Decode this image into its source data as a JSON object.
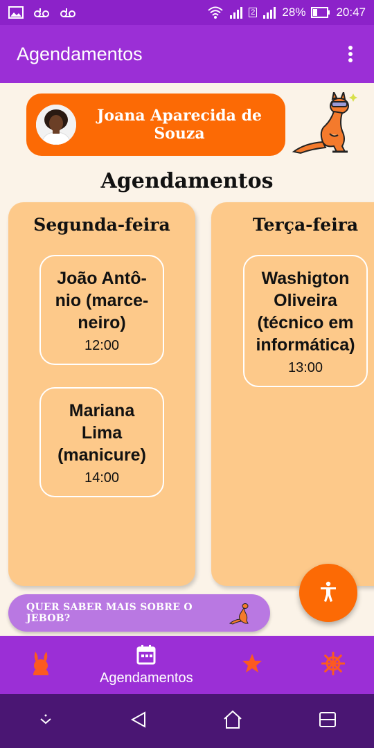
{
  "status_bar": {
    "sim_index": "2",
    "battery": "28%",
    "time": "20:47"
  },
  "app_bar": {
    "title": "Agendamentos"
  },
  "user": {
    "name": "Joana Aparecida de Souza"
  },
  "section_title": "Agendamentos",
  "days": [
    {
      "label": "Segunda-feira",
      "appointments": [
        {
          "name": "João Antô-nio (marce-neiro)",
          "line1": "João Antô-",
          "line2": "nio (marce-",
          "line3": "neiro)",
          "time": "12:00"
        },
        {
          "name": "Mariana Lima (manicure)",
          "line1": "Mariana",
          "line2": "Lima",
          "line3": "(manicure)",
          "time": "14:00"
        }
      ]
    },
    {
      "label": "Terça-feira",
      "appointments": [
        {
          "name": "Washigton Oliveira (técnico em informática)",
          "line1": "Washigton",
          "line2": "Oliveira",
          "line3": "(técnico em",
          "line4": "informática)",
          "time": "13:00"
        }
      ]
    }
  ],
  "info_banner": {
    "text": "QUER SABER MAIS SOBRE O JEBOB?"
  },
  "bottom_nav": {
    "items": [
      {
        "icon": "rabbit-icon",
        "label": ""
      },
      {
        "icon": "calendar-icon",
        "label": "Agendamentos"
      },
      {
        "icon": "star-icon",
        "label": ""
      },
      {
        "icon": "ship-wheel-icon",
        "label": ""
      }
    ]
  },
  "colors": {
    "primary_purple": "#9b2fd6",
    "accent_orange": "#fc6a05",
    "card_peach": "#fdc98a",
    "background": "#fbf3e8"
  }
}
